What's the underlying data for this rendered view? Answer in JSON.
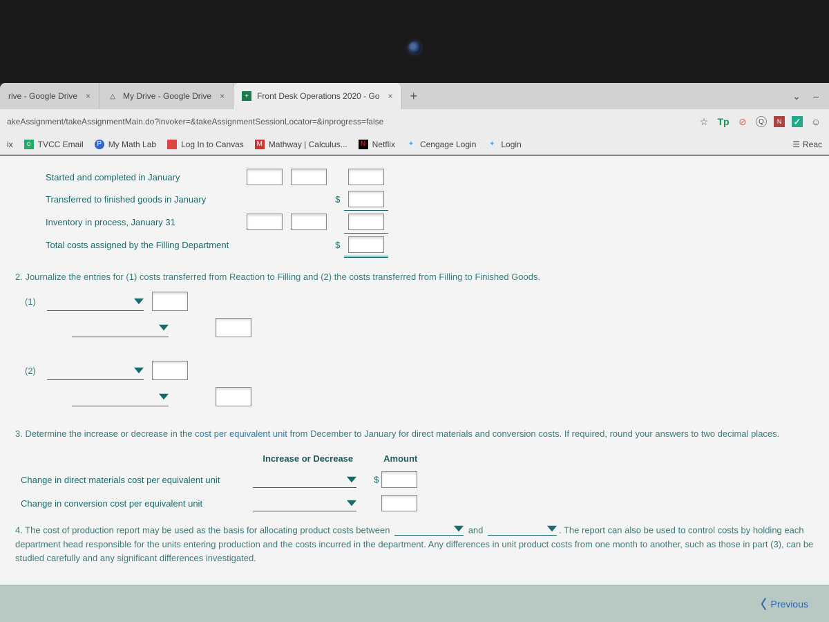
{
  "tabs": [
    {
      "label": "rive - Google Drive",
      "favicon": ""
    },
    {
      "label": "My Drive - Google Drive",
      "favicon": "△"
    },
    {
      "label": "Front Desk Operations 2020 - Go",
      "favicon": "+",
      "active": true
    }
  ],
  "plus": "+",
  "win": {
    "down": "⌄",
    "min": "–"
  },
  "url": "akeAssignment/takeAssignmentMain.do?invoker=&takeAssignmentSessionLocator=&inprogress=false",
  "url_icons": {
    "star": "☆",
    "tp": "Tp",
    "circle": "⊘",
    "q": "Q",
    "n": "N",
    "check": "✓",
    "user": "☺"
  },
  "bookmarks": [
    {
      "label": "ix",
      "icon": ""
    },
    {
      "label": "TVCC Email",
      "icon": "o",
      "cls": "bk-o"
    },
    {
      "label": "My Math Lab",
      "icon": "P",
      "cls": "bk-p"
    },
    {
      "label": "Log In to Canvas",
      "icon": "!",
      "cls": "bk-i"
    },
    {
      "label": "Mathway | Calculus...",
      "icon": "M",
      "cls": "bk-m"
    },
    {
      "label": "Netflix",
      "icon": "N",
      "cls": "bk-n"
    },
    {
      "label": "Cengage Login",
      "icon": "✦",
      "cls": "bk-c"
    },
    {
      "label": "Login",
      "icon": "✦",
      "cls": "bk-l"
    }
  ],
  "reading_list": "Reac",
  "cost_rows": [
    "Started and completed in January",
    "Transferred to finished goods in January",
    "Inventory in process, January 31",
    "Total costs assigned by the Filling Department"
  ],
  "dollar": "$",
  "q2": {
    "heading": "2. Journalize the entries for (1) costs transferred from Reaction to Filling and (2) the costs transferred from Filling to Finished Goods.",
    "labels": [
      "(1)",
      "(2)"
    ]
  },
  "q3": {
    "prefix": "3. Determine the increase or decrease in the ",
    "link": "cost per equivalent unit",
    "suffix": " from December to January for direct materials and conversion costs. If required, round your answers to two decimal places.",
    "headers": [
      "Increase or Decrease",
      "Amount"
    ],
    "rows": [
      "Change in direct materials cost per equivalent unit",
      "Change in conversion cost per equivalent unit"
    ]
  },
  "q4": {
    "p1": "4. The cost of production report may be used as the basis for allocating product costs between ",
    "and": " and ",
    "p2": ". The report can also be used to control costs by holding each department head responsible for the units entering production and the costs incurred in the department. Any differences in unit product costs from one month to another, such as those in part (3), can be studied carefully and any significant differences investigated."
  },
  "footer": {
    "prev": "Previous"
  }
}
